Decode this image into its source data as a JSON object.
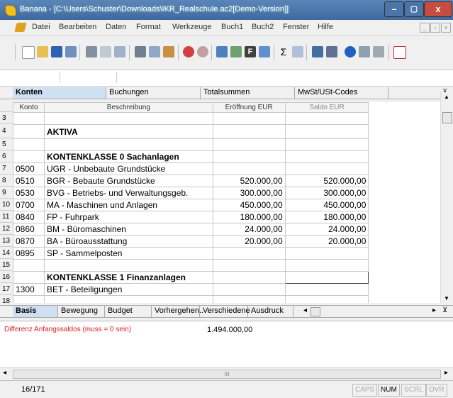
{
  "window": {
    "title": "Banana - [C:\\Users\\Schuster\\Downloads\\IKR_Realschule.ac2[Demo-Version]]",
    "minimize": "–",
    "maximize": "▢",
    "close": "x"
  },
  "menu": {
    "items": [
      "Datei",
      "Bearbeiten",
      "Daten",
      "Format",
      "Werkzeuge",
      "Buch1",
      "Buch2",
      "Fenster",
      "Hilfe"
    ]
  },
  "top_tabs": [
    "Konten",
    "Buchungen",
    "Totalsummen",
    "MwSt/USt-Codes"
  ],
  "columns": {
    "konto": "Konto",
    "beschreibung": "Beschreibung",
    "eroeffnung": "Eröffnung EUR",
    "saldo": "Saldo EUR"
  },
  "rows": [
    {
      "n": "3",
      "konto": "",
      "desc": "",
      "eroeffnung": "",
      "saldo": ""
    },
    {
      "n": "4",
      "konto": "",
      "desc": "AKTIVA",
      "eroeffnung": "",
      "saldo": "",
      "style": "big"
    },
    {
      "n": "5",
      "konto": "",
      "desc": "",
      "eroeffnung": "",
      "saldo": ""
    },
    {
      "n": "6",
      "konto": "",
      "desc": "KONTENKLASSE 0  Sachanlagen",
      "eroeffnung": "",
      "saldo": "",
      "style": "bold"
    },
    {
      "n": "7",
      "konto": "0500",
      "desc": "UGR - Unbebaute Grundstücke",
      "eroeffnung": "",
      "saldo": ""
    },
    {
      "n": "8",
      "konto": "0510",
      "desc": "BGR - Bebaute Grundstücke",
      "eroeffnung": "520.000,00",
      "saldo": "520.000,00"
    },
    {
      "n": "9",
      "konto": "0530",
      "desc": "BVG - Betriebs- und Verwaltungsgeb.",
      "eroeffnung": "300.000,00",
      "saldo": "300.000,00"
    },
    {
      "n": "10",
      "konto": "0700",
      "desc": "MA - Maschinen und Anlagen",
      "eroeffnung": "450.000,00",
      "saldo": "450.000,00"
    },
    {
      "n": "11",
      "konto": "0840",
      "desc": "FP - Fuhrpark",
      "eroeffnung": "180.000,00",
      "saldo": "180.000,00"
    },
    {
      "n": "12",
      "konto": "0860",
      "desc": "BM - Büromaschinen",
      "eroeffnung": "24.000,00",
      "saldo": "24.000,00"
    },
    {
      "n": "13",
      "konto": "0870",
      "desc": "BA - Büroausstattung",
      "eroeffnung": "20.000,00",
      "saldo": "20.000,00"
    },
    {
      "n": "14",
      "konto": "0895",
      "desc": "SP - Sammelposten",
      "eroeffnung": "",
      "saldo": ""
    },
    {
      "n": "15",
      "konto": "",
      "desc": "",
      "eroeffnung": "",
      "saldo": ""
    },
    {
      "n": "16",
      "konto": "",
      "desc": "KONTENKLASSE 1  Finanzanlagen",
      "eroeffnung": "",
      "saldo": "",
      "style": "bold"
    },
    {
      "n": "17",
      "konto": "1300",
      "desc": "BET - Beteiligungen",
      "eroeffnung": "",
      "saldo": ""
    },
    {
      "n": "18",
      "konto": "",
      "desc": "",
      "eroeffnung": "",
      "saldo": ""
    }
  ],
  "bottom_tabs": [
    "Basis",
    "Bewegung",
    "Budget",
    "Vorhergehen..",
    "Verschiedene",
    "Ausdruck"
  ],
  "info": {
    "message": "Differenz Anfangssaldos (muss = 0 sein)",
    "value": "1.494.000,00",
    "message_color": "#e02020"
  },
  "hscroll_grip": "III",
  "status": {
    "position": "16/171",
    "indicators": [
      "CAPS",
      "NUM",
      "SCRL",
      "OVR"
    ]
  }
}
